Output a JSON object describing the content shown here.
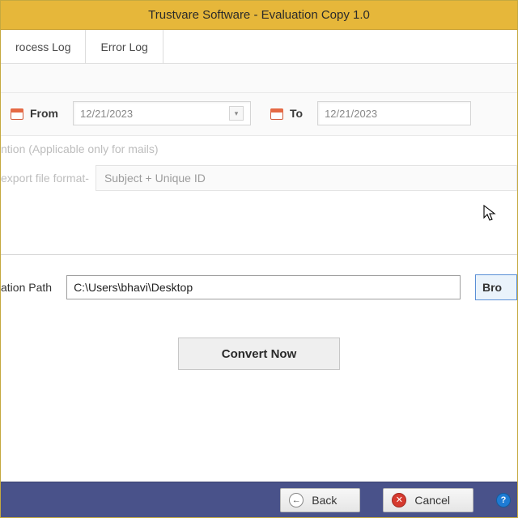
{
  "window": {
    "title": "Trustvare Software - Evaluation Copy 1.0"
  },
  "tabs": {
    "process_log": "rocess Log",
    "error_log": "Error Log"
  },
  "dates": {
    "from_label": "From",
    "from_value": "12/21/2023",
    "to_label": "To",
    "to_value": "12/21/2023"
  },
  "naming": {
    "note": "ntion (Applicable only for mails)",
    "format_label": "export file format-",
    "format_value": "Subject + Unique ID"
  },
  "path": {
    "label": "ation Path",
    "value": "C:\\Users\\bhavi\\Desktop",
    "browse": "Bro"
  },
  "actions": {
    "convert": "Convert Now"
  },
  "footer": {
    "back": "Back",
    "cancel": "Cancel"
  }
}
